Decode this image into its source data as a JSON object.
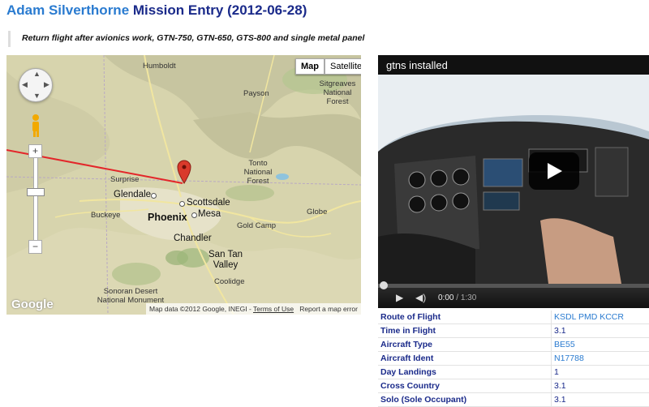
{
  "header": {
    "pilot_name": "Adam Silverthorne",
    "rest": "Mission Entry (2012-06-28)"
  },
  "description": "Return flight after avionics work, GTN-750, GTN-650, GTS-800 and single metal panel",
  "map": {
    "type_buttons": [
      "Map",
      "Satellite"
    ],
    "active_type": "Map",
    "labels": {
      "humboldt": "Humboldt",
      "payson": "Payson",
      "sitgreaves": "Sitgreaves National Forest",
      "tonto": "Tonto National Forest",
      "surprise": "Surprise",
      "glendale": "Glendale",
      "scottsdale": "Scottsdale",
      "phoenix": "Phoenix",
      "mesa": "Mesa",
      "buckeye": "Buckeye",
      "gold_camp": "Gold Camp",
      "globe": "Globe",
      "chandler": "Chandler",
      "san_tan": "San Tan Valley",
      "coolidge": "Coolidge",
      "sonoran": "Sonoran Desert National Monument"
    },
    "logo": "Google",
    "attribution": "Map data ©2012 Google, INEGI -",
    "terms": "Terms of Use",
    "report": "Report a map error",
    "colors": {
      "route": "#e3262a",
      "marker": "#d93a2b"
    }
  },
  "video": {
    "title": "gtns installed",
    "current_time": "0:00",
    "duration": "1:30"
  },
  "stats": [
    {
      "label": "Route of Flight",
      "value": "KSDL PMD KCCR",
      "link": true
    },
    {
      "label": "Time in Flight",
      "value": "3.1",
      "link": false
    },
    {
      "label": "Aircraft Type",
      "value": "BE55",
      "link": true
    },
    {
      "label": "Aircraft Ident",
      "value": "N17788",
      "link": true
    },
    {
      "label": "Day Landings",
      "value": "1",
      "link": false
    },
    {
      "label": "Cross Country",
      "value": "3.1",
      "link": false
    },
    {
      "label": "Solo (Sole Occupant)",
      "value": "3.1",
      "link": false
    }
  ]
}
